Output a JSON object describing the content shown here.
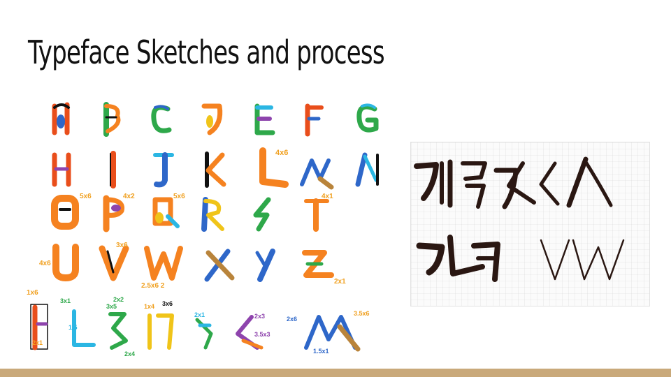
{
  "slide": {
    "title": "Typeface Sketches and process",
    "accent_color": "#c9a97a"
  },
  "sketch_sheet": {
    "rows": [
      [
        "A",
        "B",
        "C",
        "D",
        "E",
        "F",
        "G"
      ],
      [
        "H",
        "I",
        "J",
        "K",
        "L",
        "M",
        "N"
      ],
      [
        "O",
        "P",
        "Q",
        "R",
        "S",
        "T"
      ],
      [
        "U",
        "V",
        "W",
        "X",
        "Y",
        "Z"
      ]
    ],
    "size_notes": [
      "4x6",
      "5x6",
      "4x2",
      "5x6",
      "3x6",
      "4x1",
      "4x6",
      "2x1",
      "1x6",
      "3x1",
      "2x1",
      "3x5",
      "2x2",
      "3x6",
      "1x4",
      "2x1",
      "2x3",
      "3.5x3",
      "2x6",
      "3.5x6",
      "1.5x1",
      "2x4",
      "1.5"
    ],
    "stroke_colors": [
      "#e94e1b",
      "#f58220",
      "#2e67c9",
      "#2bb6e3",
      "#8e44ad",
      "#2ea84a",
      "#f0c419",
      "#b9843b",
      "#111111"
    ]
  },
  "grid_panel": {
    "description_icon": "brush-glyph-grid-icon",
    "ink_color": "#2a1712"
  }
}
